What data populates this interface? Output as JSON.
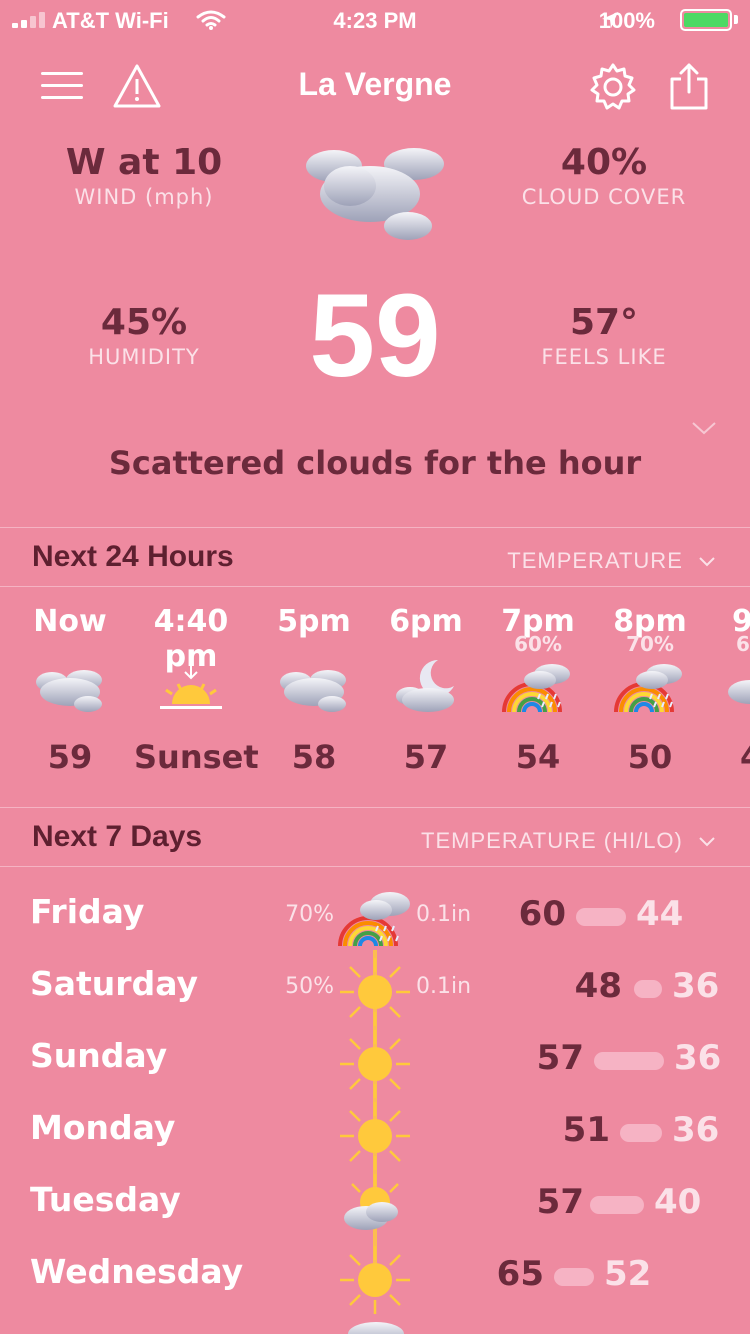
{
  "status": {
    "carrier": "AT&T Wi-Fi",
    "time": "4:23 PM",
    "battery": "100%"
  },
  "header": {
    "city": "La Vergne"
  },
  "current": {
    "wind_value": "W at 10",
    "wind_label": "WIND (mph)",
    "cloud_value": "40%",
    "cloud_label": "CLOUD COVER",
    "humidity_value": "45%",
    "humidity_label": "HUMIDITY",
    "feels_value": "57°",
    "feels_label": "FEELS LIKE",
    "temp": "59",
    "summary": "Scattered clouds for the hour"
  },
  "hourly_section": {
    "title": "Next 24 Hours",
    "selector": "TEMPERATURE"
  },
  "hourly": [
    {
      "time": "Now",
      "precip": "",
      "icon": "cloud-icon",
      "value": "59"
    },
    {
      "time": "4:40 pm",
      "precip": "",
      "icon": "sunset-icon",
      "value": "Sunset"
    },
    {
      "time": "5pm",
      "precip": "",
      "icon": "cloud-icon",
      "value": "58"
    },
    {
      "time": "6pm",
      "precip": "",
      "icon": "moon-cloud-icon",
      "value": "57"
    },
    {
      "time": "7pm",
      "precip": "60%",
      "icon": "rainbow-rain-icon",
      "value": "54"
    },
    {
      "time": "8pm",
      "precip": "70%",
      "icon": "rainbow-rain-icon",
      "value": "50"
    },
    {
      "time": "9",
      "precip": "6",
      "icon": "rain-icon",
      "value": "4"
    }
  ],
  "daily_section": {
    "title": "Next 7 Days",
    "selector": "TEMPERATURE (HI/LO)"
  },
  "daily": [
    {
      "day": "Friday",
      "precip": "70%",
      "amount": "0.1in",
      "icon": "rainbow-rain-icon",
      "hi": "60",
      "lo": "44"
    },
    {
      "day": "Saturday",
      "precip": "50%",
      "amount": "0.1in",
      "icon": "sun-icon",
      "hi": "48",
      "lo": "36"
    },
    {
      "day": "Sunday",
      "precip": "",
      "amount": "",
      "icon": "sun-icon",
      "hi": "57",
      "lo": "36"
    },
    {
      "day": "Monday",
      "precip": "",
      "amount": "",
      "icon": "sun-icon",
      "hi": "51",
      "lo": "36"
    },
    {
      "day": "Tuesday",
      "precip": "",
      "amount": "",
      "icon": "sun-cloud-icon",
      "hi": "57",
      "lo": "40"
    },
    {
      "day": "Wednesday",
      "precip": "",
      "amount": "",
      "icon": "sun-icon",
      "hi": "65",
      "lo": "52"
    }
  ]
}
